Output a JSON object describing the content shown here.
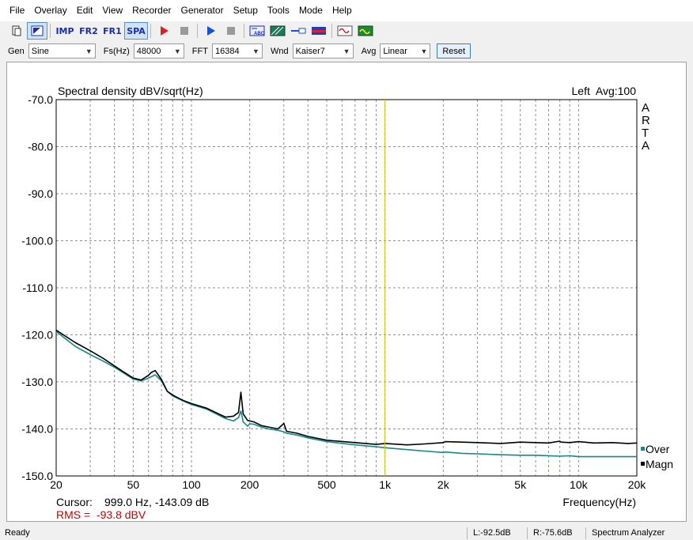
{
  "menu": [
    "File",
    "Overlay",
    "Edit",
    "View",
    "Recorder",
    "Generator",
    "Setup",
    "Tools",
    "Mode",
    "Help"
  ],
  "toolbar": {
    "imp_label": "IMP",
    "fr2_label": "FR2",
    "fr1_label": "FR1",
    "spa_label": "SPA",
    "icons": [
      "new-doc-icon",
      "pointer-icon",
      "record-icon",
      "stop-icon",
      "play-icon",
      "stop-icon",
      "text-abc-icon",
      "pattern-icon",
      "link-icon",
      "meter-icon",
      "sine-wave-icon",
      "green-wave-icon"
    ]
  },
  "controls": {
    "gen_label": "Gen",
    "gen_value": "Sine",
    "fs_label": "Fs(Hz)",
    "fs_value": "48000",
    "fft_label": "FFT",
    "fft_value": "16384",
    "wnd_label": "Wnd",
    "wnd_value": "Kaiser7",
    "avg_label": "Avg",
    "avg_value": "Linear",
    "reset_label": "Reset"
  },
  "plot": {
    "title": "Spectral density dBV/sqrt(Hz)",
    "channel_label": "Left  Avg:100",
    "brand_letters": [
      "A",
      "R",
      "T",
      "A"
    ],
    "cursor_label": "Cursor:",
    "cursor_value": "999.0 Hz, -143.09 dB",
    "rms_label": "RMS =  -93.8 dBV",
    "legend_over": "Over",
    "legend_magn": "Magn"
  },
  "chart_data": {
    "type": "line",
    "xlabel": "Frequency(Hz)",
    "ylabel": "Spectral density dBV/sqrt(Hz)",
    "x_scale": "log",
    "xlim": [
      20,
      20000
    ],
    "ylim": [
      -150,
      -70
    ],
    "x_ticks": [
      20,
      50,
      100,
      200,
      500,
      1000,
      2000,
      5000,
      10000,
      20000
    ],
    "x_tick_labels": [
      "20",
      "50",
      "100",
      "200",
      "500",
      "1k",
      "2k",
      "5k",
      "10k",
      "20k"
    ],
    "y_ticks": [
      -70,
      -80,
      -90,
      -100,
      -110,
      -120,
      -130,
      -140,
      -150
    ],
    "y_tick_labels": [
      "-70.0",
      "-80.0",
      "-90.0",
      "-100.0",
      "-110.0",
      "-120.0",
      "-130.0",
      "-140.0",
      "-150.0"
    ],
    "grid": true,
    "cursor_x": 999,
    "colors": {
      "magn": "#000000",
      "over": "#14888a",
      "cursor": "#c8c800",
      "grid": "#909090",
      "rms": "#c80000"
    },
    "series": [
      {
        "name": "Magn",
        "x": [
          20,
          25,
          30,
          35,
          40,
          45,
          50,
          55,
          60,
          62,
          65,
          70,
          75,
          80,
          90,
          100,
          120,
          150,
          165,
          175,
          180,
          185,
          195,
          200,
          210,
          230,
          250,
          280,
          300,
          310,
          350,
          400,
          500,
          700,
          900,
          1000,
          1300,
          1600,
          2000,
          2050,
          2500,
          3000,
          4000,
          5000,
          6000,
          7000,
          8000,
          8100,
          9000,
          10000,
          12000,
          15000,
          18000,
          20000
        ],
        "y": [
          -119,
          -121.6,
          -123.4,
          -125,
          -126.6,
          -128,
          -129.2,
          -129.6,
          -128.6,
          -128,
          -127.6,
          -129.5,
          -132,
          -132.8,
          -133.9,
          -134.6,
          -135.6,
          -137.5,
          -137.3,
          -136.5,
          -132.2,
          -136.8,
          -138.2,
          -138.3,
          -138.5,
          -139.3,
          -139.6,
          -140,
          -138.8,
          -140.5,
          -140.9,
          -141.6,
          -142.4,
          -142.9,
          -143.3,
          -143.1,
          -143.4,
          -143.2,
          -142.9,
          -142.7,
          -142.8,
          -142.9,
          -143.1,
          -142.8,
          -142.9,
          -143,
          -142.6,
          -142.8,
          -142.9,
          -142.7,
          -143,
          -142.9,
          -143.1,
          -143
        ]
      },
      {
        "name": "Over",
        "x": [
          20,
          25,
          30,
          35,
          40,
          45,
          50,
          55,
          60,
          62,
          65,
          70,
          75,
          80,
          90,
          100,
          120,
          150,
          165,
          175,
          180,
          185,
          195,
          200,
          210,
          230,
          250,
          280,
          300,
          310,
          350,
          400,
          500,
          700,
          900,
          1000,
          1300,
          1600,
          2000,
          2050,
          2500,
          3000,
          4000,
          5000,
          6000,
          7000,
          8000,
          9000,
          10000,
          12000,
          15000,
          18000,
          20000
        ],
        "y": [
          -119.3,
          -122.4,
          -124.2,
          -125.6,
          -126.9,
          -128.2,
          -129.4,
          -129.8,
          -129.2,
          -128.9,
          -128.5,
          -129.8,
          -132,
          -133,
          -134,
          -134.8,
          -135.8,
          -137.8,
          -138.3,
          -137.6,
          -136.2,
          -138.5,
          -139.4,
          -138.9,
          -139,
          -139.6,
          -140,
          -140.3,
          -140.6,
          -140.9,
          -141.3,
          -141.9,
          -142.7,
          -143.4,
          -143.8,
          -144,
          -144.4,
          -144.7,
          -145,
          -144.9,
          -145.2,
          -145.3,
          -145.5,
          -145.6,
          -145.6,
          -145.7,
          -145.8,
          -145.7,
          -145.9,
          -145.9,
          -145.9,
          -145.9,
          -145.9
        ]
      }
    ]
  },
  "status": {
    "ready": "Ready",
    "left_level": "L:-92.5dB",
    "right_level": "R:-75.6dB",
    "mode": "Spectrum Analyzer"
  }
}
